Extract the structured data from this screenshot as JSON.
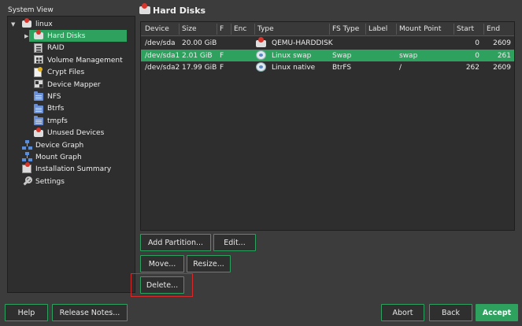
{
  "system_view": {
    "title": "System View",
    "tree": [
      {
        "label": "linux",
        "icon": "disk-icon",
        "level": 0,
        "expanded": true
      },
      {
        "label": "Hard Disks",
        "icon": "disk-icon",
        "level": 1,
        "selected": true,
        "collapsed": true
      },
      {
        "label": "RAID",
        "icon": "raid-icon",
        "level": 1
      },
      {
        "label": "Volume Management",
        "icon": "volume-icon",
        "level": 1
      },
      {
        "label": "Crypt Files",
        "icon": "file-icon",
        "level": 1
      },
      {
        "label": "Device Mapper",
        "icon": "mapper-icon",
        "level": 1
      },
      {
        "label": "NFS",
        "icon": "folder-icon",
        "level": 1
      },
      {
        "label": "Btrfs",
        "icon": "folder-icon",
        "level": 1
      },
      {
        "label": "tmpfs",
        "icon": "folder-icon",
        "level": 1
      },
      {
        "label": "Unused Devices",
        "icon": "disk-icon",
        "level": 1
      },
      {
        "label": "Device Graph",
        "icon": "graph-icon",
        "level": 0
      },
      {
        "label": "Mount Graph",
        "icon": "graph-icon",
        "level": 0
      },
      {
        "label": "Installation Summary",
        "icon": "summary-icon",
        "level": 0
      },
      {
        "label": "Settings",
        "icon": "wrench-icon",
        "level": 0
      }
    ]
  },
  "header": {
    "title": "Hard Disks"
  },
  "table": {
    "columns": [
      "Device",
      "Size",
      "F",
      "Enc",
      "Type",
      "FS Type",
      "Label",
      "Mount Point",
      "Start",
      "End"
    ],
    "rows": [
      {
        "device": "/dev/sda",
        "size": "20.00 GiB",
        "f": "",
        "enc": "",
        "type": "QEMU-HARDDISK",
        "type_icon": "disk-icon",
        "fs_type": "",
        "label": "",
        "mount": "",
        "start": "0",
        "end": "2609",
        "selected": false
      },
      {
        "device": "/dev/sda1",
        "size": "2.01 GiB",
        "f": "F",
        "enc": "",
        "type": "Linux swap",
        "type_icon": "swap-icon",
        "fs_type": "Swap",
        "label": "",
        "mount": "swap",
        "start": "0",
        "end": "261",
        "selected": true
      },
      {
        "device": "/dev/sda2",
        "size": "17.99 GiB",
        "f": "F",
        "enc": "",
        "type": "Linux native",
        "type_icon": "swap-icon",
        "fs_type": "BtrFS",
        "label": "",
        "mount": "/",
        "start": "262",
        "end": "2609",
        "selected": false
      }
    ]
  },
  "actions": {
    "add_partition": "Add Partition...",
    "edit": "Edit...",
    "move": "Move...",
    "resize": "Resize...",
    "delete": "Delete..."
  },
  "footer": {
    "help": "Help",
    "release_notes": "Release Notes...",
    "abort": "Abort",
    "back": "Back",
    "accept": "Accept"
  },
  "colors": {
    "accent": "#2ea15f",
    "background": "#3c3c3c",
    "focus": "#d62a2a"
  }
}
